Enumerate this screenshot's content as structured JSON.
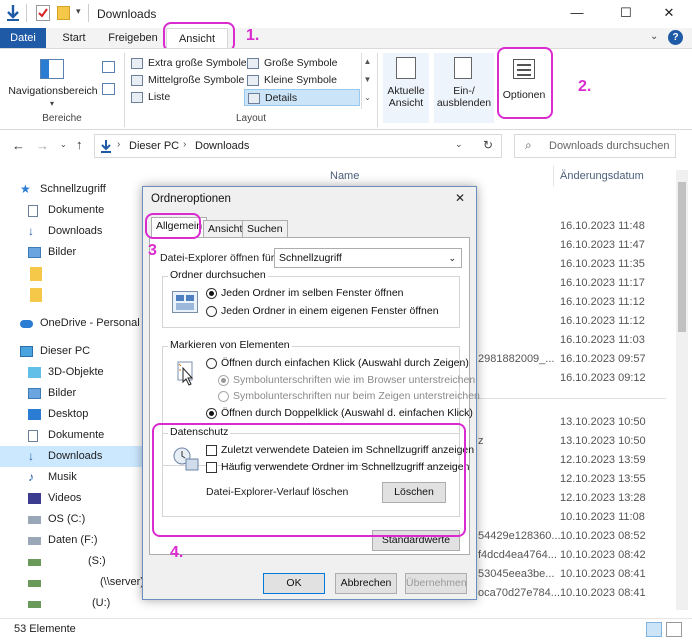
{
  "window": {
    "title": "Downloads",
    "minimize": "—",
    "maximize": "☐",
    "close": "✕"
  },
  "ribbon_tabs": [
    "Datei",
    "Start",
    "Freigeben",
    "Ansicht"
  ],
  "ribbon": {
    "bereiche": {
      "nav_pane_label": "Navigationsbereich",
      "group_label": "Bereiche"
    },
    "layout": {
      "items": [
        "Extra große Symbole",
        "Große Symbole",
        "Mittelgroße Symbole",
        "Kleine Symbole",
        "Liste",
        "Details"
      ],
      "selected": "Details",
      "group_label": "Layout"
    },
    "current_view_label": "Aktuelle Ansicht",
    "show_hide_label": "Ein-/ ausblenden",
    "options_label": "Optionen"
  },
  "annotations": {
    "step1": "1.",
    "step2": "2.",
    "step3": "3",
    "step4": "4."
  },
  "addressbar": {
    "path": [
      "Dieser PC",
      "Downloads"
    ],
    "search_placeholder": "Downloads durchsuchen"
  },
  "columns": {
    "name": "Name",
    "date": "Änderungsdatum"
  },
  "sidebar": {
    "quick_access": "Schnellzugriff",
    "items_quick": [
      "Dokumente",
      "Downloads",
      "Bilder"
    ],
    "onedrive": "OneDrive - Personal",
    "this_pc": "Dieser PC",
    "items_pc": [
      "3D-Objekte",
      "Bilder",
      "Desktop",
      "Dokumente",
      "Downloads",
      "Musik",
      "Videos",
      "OS (C:)",
      "Daten (F:)",
      "(S:)",
      "(\\\\server)",
      "(U:)"
    ]
  },
  "file_rows": {
    "group1": [
      {
        "name": "",
        "date": "16.10.2023 11:48"
      },
      {
        "name": "",
        "date": "16.10.2023 11:47"
      },
      {
        "name": "",
        "date": "16.10.2023 11:35"
      },
      {
        "name": "",
        "date": "16.10.2023 11:17"
      },
      {
        "name": "",
        "date": "16.10.2023 11:12"
      },
      {
        "name": "",
        "date": "16.10.2023 11:12"
      },
      {
        "name": "",
        "date": "16.10.2023 11:03"
      },
      {
        "name": "2981882009_...",
        "date": "16.10.2023 09:57"
      },
      {
        "name": "",
        "date": "16.10.2023 09:12"
      }
    ],
    "group2": [
      {
        "name": "",
        "date": "13.10.2023 10:50"
      },
      {
        "name": "z",
        "date": "13.10.2023 10:50"
      },
      {
        "name": "",
        "date": "12.10.2023 13:59"
      },
      {
        "name": "",
        "date": "12.10.2023 13:55"
      },
      {
        "name": "",
        "date": "12.10.2023 13:28"
      },
      {
        "name": "",
        "date": "10.10.2023 11:08"
      },
      {
        "name": "54429e128360...",
        "date": "10.10.2023 08:52"
      },
      {
        "name": "f4dcd4ea4764...",
        "date": "10.10.2023 08:42"
      },
      {
        "name": "53045eea3be...",
        "date": "10.10.2023 08:41"
      },
      {
        "name": "oca70d27e784...",
        "date": "10.10.2023 08:41"
      }
    ]
  },
  "status": {
    "count": "53 Elemente"
  },
  "dialog": {
    "title": "Ordneroptionen",
    "close": "✕",
    "tabs": [
      "Allgemein",
      "Ansicht",
      "Suchen"
    ],
    "open_for_label": "Datei-Explorer öffnen für:",
    "open_for_value": "Schnellzugriff",
    "browse": {
      "title": "Ordner durchsuchen",
      "options": [
        "Jeden Ordner im selben Fenster öffnen",
        "Jeden Ordner in einem eigenen Fenster öffnen"
      ],
      "selected_index": 0
    },
    "click": {
      "title": "Markieren von Elementen",
      "opt_single": "Öffnen durch einfachen Klick (Auswahl durch Zeigen)",
      "sub1": "Symbolunterschriften wie im Browser unterstreichen",
      "sub2": "Symbolunterschriften nur beim Zeigen unterstreichen",
      "opt_double": "Öffnen durch Doppelklick (Auswahl d. einfachen Klick)"
    },
    "privacy": {
      "title": "Datenschutz",
      "chk1": "Zuletzt verwendete Dateien im Schnellzugriff anzeigen",
      "chk2": "Häufig verwendete Ordner im Schnellzugriff anzeigen",
      "clear_label": "Datei-Explorer-Verlauf löschen",
      "clear_button": "Löschen"
    },
    "defaults_button": "Standardwerte",
    "ok": "OK",
    "cancel": "Abbrechen",
    "apply": "Übernehmen"
  }
}
